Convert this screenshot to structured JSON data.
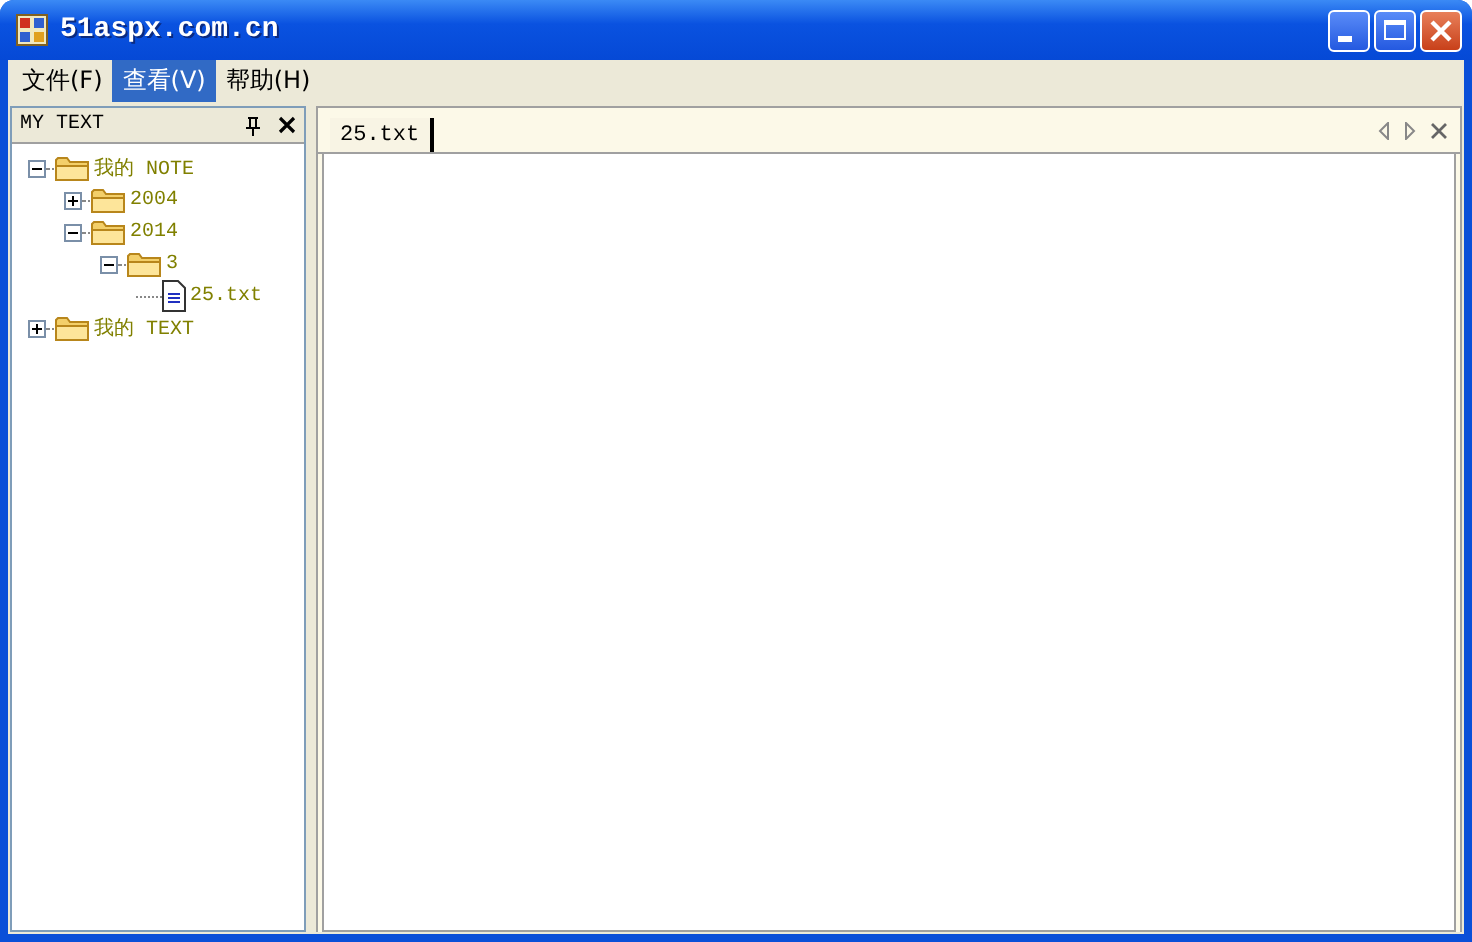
{
  "window": {
    "title": "51aspx.com.cn"
  },
  "menu": [
    {
      "label": "文件(F)",
      "selected": false
    },
    {
      "label": "查看(V)",
      "selected": true
    },
    {
      "label": "帮助(H)",
      "selected": false
    }
  ],
  "panel": {
    "title": "MY TEXT"
  },
  "tree": [
    {
      "label": "我的 NOTE",
      "kind": "folder",
      "expanded": true,
      "children": [
        {
          "label": "2004",
          "kind": "folder",
          "expanded": false
        },
        {
          "label": "2014",
          "kind": "folder",
          "expanded": true,
          "children": [
            {
              "label": "3",
              "kind": "folder",
              "expanded": true,
              "children": [
                {
                  "label": "25.txt",
                  "kind": "file"
                }
              ]
            }
          ]
        }
      ]
    },
    {
      "label": "我的 TEXT",
      "kind": "folder",
      "expanded": false
    }
  ],
  "tabs": [
    {
      "label": "25.txt",
      "selected": true
    }
  ]
}
